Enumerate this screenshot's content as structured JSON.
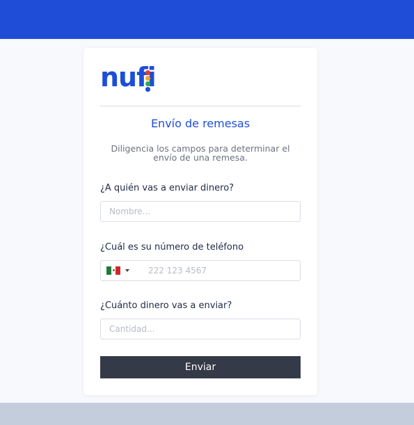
{
  "brand": {
    "logo_text": "nufi",
    "dot_colors": [
      "#e23b2e",
      "#f5a623",
      "#2eaa4a",
      "#1d4ed8"
    ]
  },
  "form": {
    "title": "Envío de remesas",
    "subtitle": "Diligencia los campos para determinar el envío de una remesa.",
    "recipient_label": "¿A quién vas a enviar dinero?",
    "recipient_placeholder": "Nombre...",
    "phone_label": "¿Cuál es su número de teléfono",
    "phone_country": "Mexico",
    "phone_placeholder": "222 123 4567",
    "amount_label": "¿Cuánto dinero vas a enviar?",
    "amount_placeholder": "Cantidad...",
    "submit_label": "Enviar"
  },
  "colors": {
    "header": "#204dd8",
    "accent": "#1d4ed8",
    "button": "#353a48",
    "footer": "#c4cddc"
  }
}
